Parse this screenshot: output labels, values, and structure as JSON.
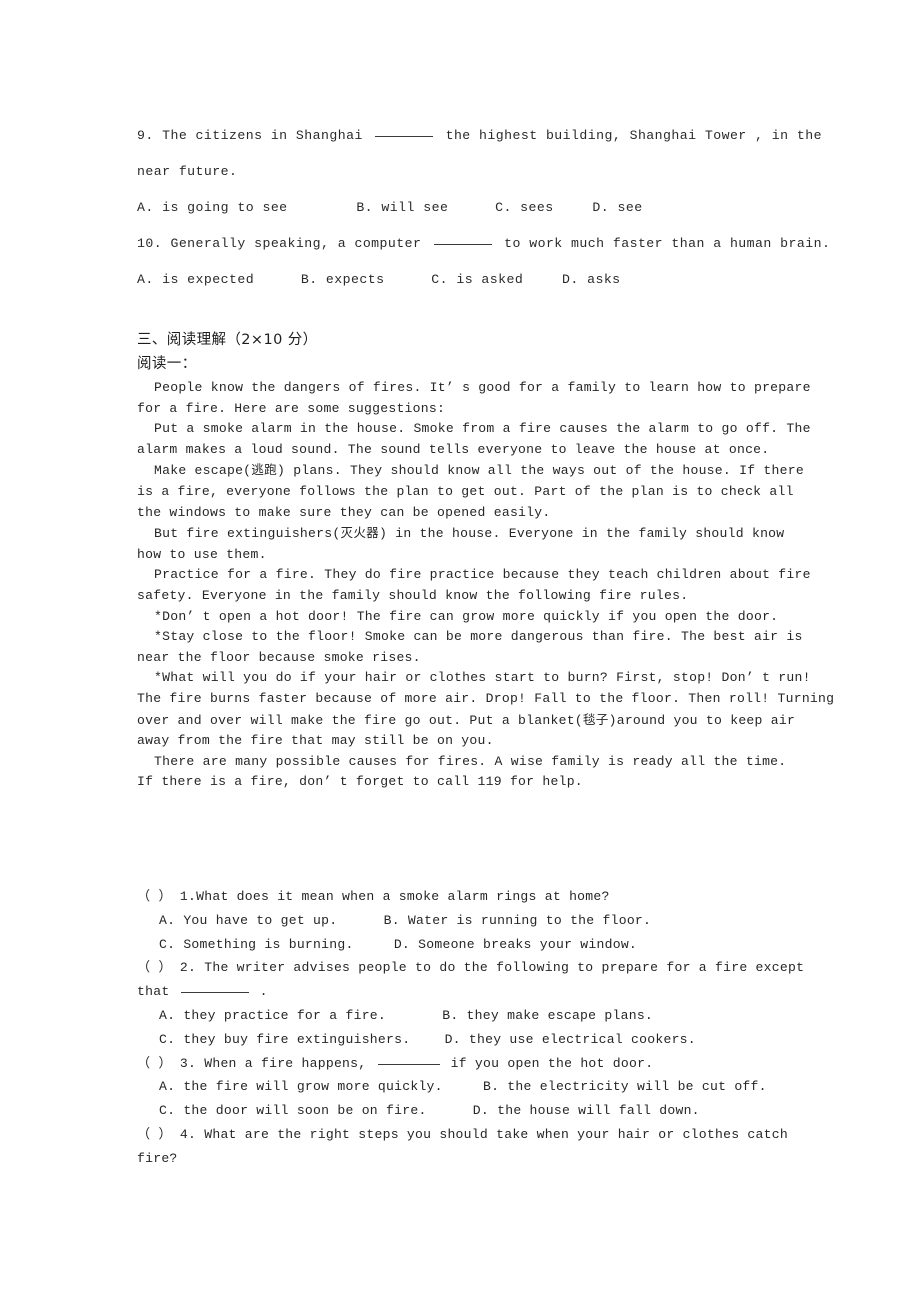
{
  "mc_items": [
    {
      "stem_line1": "9. The citizens in Shanghai",
      "stem_line1_tail": "the highest building, Shanghai Tower , in the",
      "stem_line2": "near future.",
      "options": [
        "A. is going to see",
        "B. will see",
        "C. sees",
        "D. see"
      ]
    },
    {
      "stem_line1": "10. Generally speaking, a computer",
      "stem_line1_tail": "to work much faster than a human brain.",
      "options": [
        "A. is expected",
        "B. expects",
        "C. is asked",
        "D. asks"
      ]
    }
  ],
  "section": {
    "heading": "三、阅读理解（2×10 分）",
    "subheading": "阅读一："
  },
  "passage": {
    "lines": [
      {
        "indent": true,
        "text": "People know the dangers of fires. It’ s good for a family to learn how to prepare"
      },
      {
        "indent": false,
        "text": "for a fire. Here are some suggestions:"
      },
      {
        "indent": true,
        "text": "Put a smoke alarm in the house. Smoke from a fire causes the alarm to go off. The"
      },
      {
        "indent": false,
        "text": "alarm makes a loud sound. The sound tells everyone to leave the house at once."
      },
      {
        "indent": true,
        "text": "Make escape(逃跑) plans. They should know all the ways out of the house. If there"
      },
      {
        "indent": false,
        "text": "is a fire, everyone follows the plan to get out. Part of the plan is to check all"
      },
      {
        "indent": false,
        "text": "the windows to make sure they can be opened easily."
      },
      {
        "indent": true,
        "text": "But fire extinguishers(灭火器) in the house. Everyone in the family should know"
      },
      {
        "indent": false,
        "text": "how to use them."
      },
      {
        "indent": true,
        "text": "Practice for a fire. They do fire practice because they teach children about fire"
      },
      {
        "indent": false,
        "text": "safety. Everyone in the family should know the following fire rules."
      },
      {
        "indent": true,
        "text": "*Don’ t open a hot door! The fire can grow more quickly if you open the door."
      },
      {
        "indent": true,
        "text": "*Stay close to the floor! Smoke can be more dangerous than fire. The best air is"
      },
      {
        "indent": false,
        "text": "near the floor because smoke rises."
      },
      {
        "indent": true,
        "text": "*What will you do if your hair or clothes start to burn? First, stop! Don’ t run!"
      },
      {
        "indent": false,
        "text": "The fire burns faster because of more air. Drop! Fall to the floor. Then roll! Turning"
      },
      {
        "indent": false,
        "text": "over and over will make the fire go out. Put a blanket(毯子)around you to keep air"
      },
      {
        "indent": false,
        "text": "away from the fire that may still be on you."
      },
      {
        "indent": true,
        "text": "There are many possible causes for fires. A wise family is ready all the time."
      },
      {
        "indent": false,
        "text": "If there is a fire, don’ t forget to call 119 for help."
      }
    ]
  },
  "questions": [
    {
      "number": "1",
      "bracket": "（ ）",
      "stem": "1.What does it mean when a smoke alarm rings at home?",
      "optA": "A. You have to get up.",
      "optB": "B. Water is running to the floor.",
      "optC": "C. Something is burning.",
      "optD": "D. Someone breaks your window."
    },
    {
      "number": "2",
      "bracket": "（ ）",
      "stem_l1": "2. The writer advises people to do the following to prepare for a fire except",
      "stem_l2_pre": "that",
      "stem_l2_post": ".",
      "optA": "A. they practice for a fire.",
      "optB": "B. they make escape plans.",
      "optC": "C. they buy fire extinguishers.",
      "optD": "D. they use electrical cookers."
    },
    {
      "number": "3",
      "bracket": "（ ）",
      "stem_pre": "3. When a fire happens,",
      "stem_post": "if you open the hot door.",
      "optA": "A. the fire will grow more quickly.",
      "optB": "B. the electricity will be cut off.",
      "optC": "C. the door will soon be on fire.",
      "optD": "D. the house will fall down."
    },
    {
      "number": "4",
      "bracket": "（ ）",
      "stem_l1": "4. What are the right steps you should take when your hair or clothes catch",
      "stem_l2": "fire?"
    }
  ]
}
